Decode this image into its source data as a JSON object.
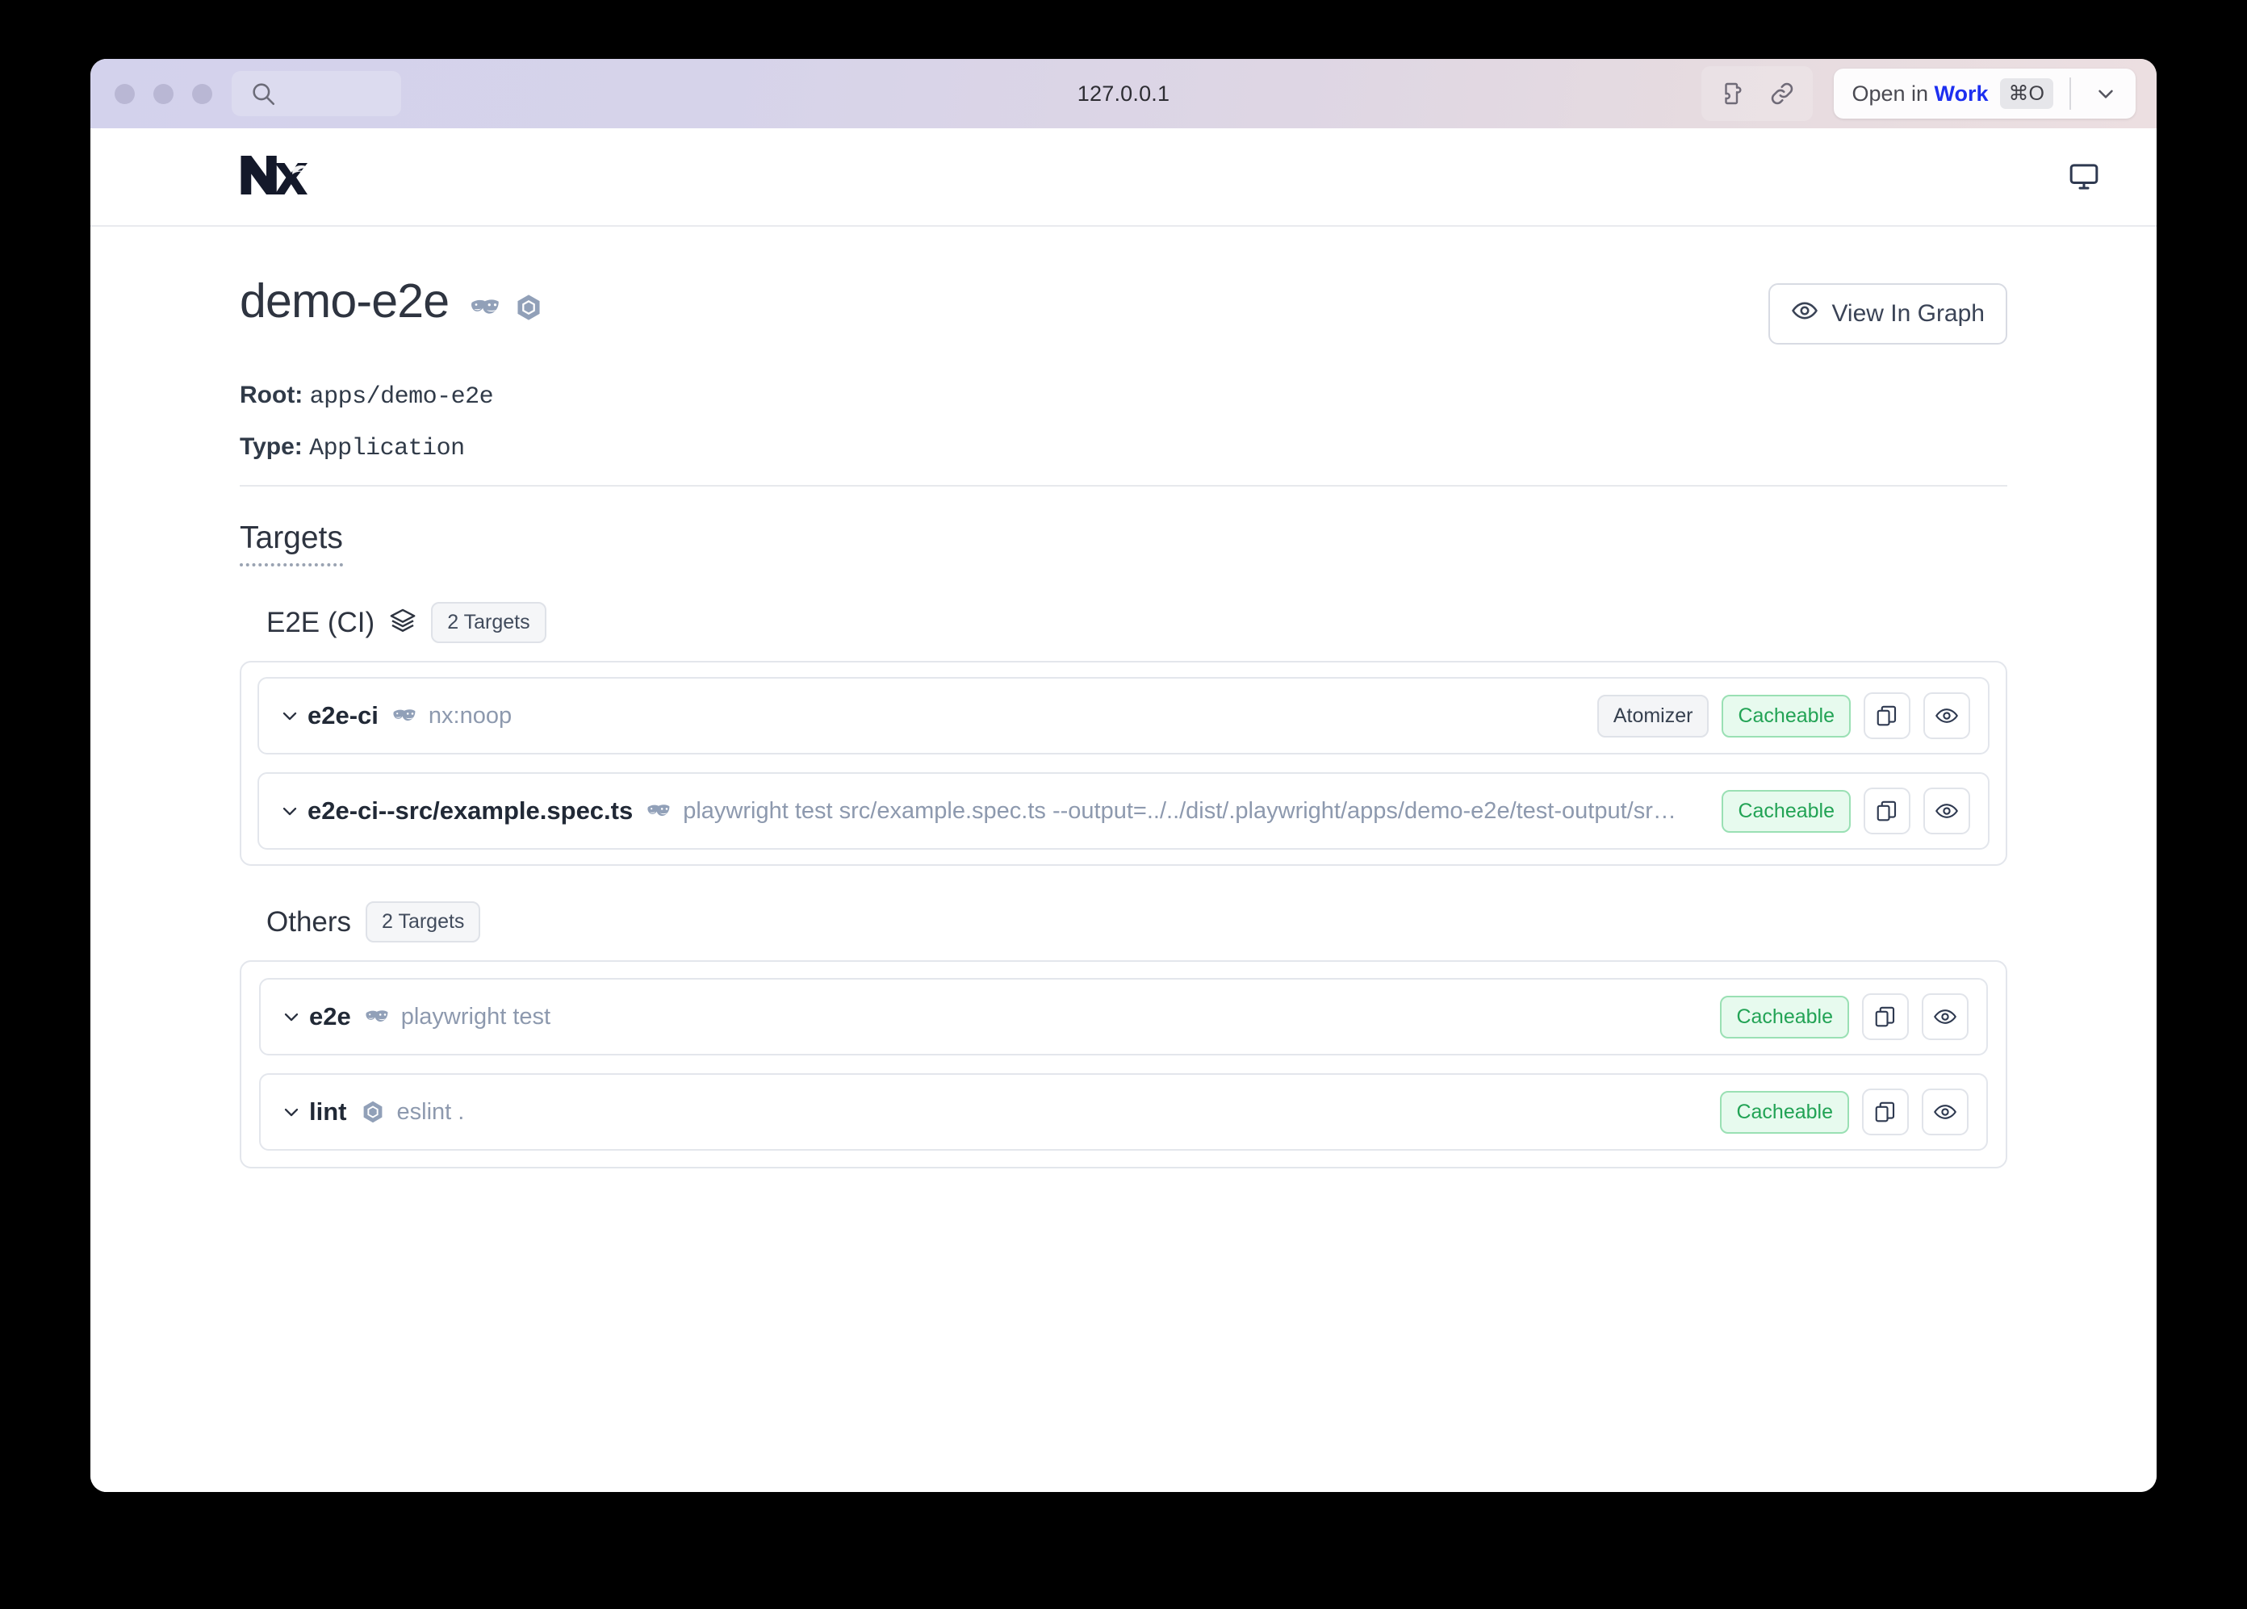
{
  "browser": {
    "url": "127.0.0.1",
    "search_icon": "search-icon",
    "extension_icon": "puzzle-piece-icon",
    "link_icon": "link-icon",
    "open_in_prefix": "Open in ",
    "open_in_app": "Work",
    "open_in_shortcut": "⌘O",
    "chevron_icon": "chevron-down-icon"
  },
  "app_header": {
    "logo": "nx-logo",
    "display_icon": "monitor-icon"
  },
  "project": {
    "title": "demo-e2e",
    "icons": [
      "playwright-masks-icon",
      "eslint-hexagon-icon"
    ],
    "view_in_graph_label": "View In Graph",
    "view_in_graph_icon": "eye-icon",
    "root_key": "Root:",
    "root_value": "apps/demo-e2e",
    "type_key": "Type:",
    "type_value": "Application"
  },
  "targets_section": {
    "heading": "Targets",
    "groups": [
      {
        "name": "E2E (CI)",
        "icon": "layers-icon",
        "count_label": "2 Targets",
        "rows": [
          {
            "chevron": "chevron-down-icon",
            "name": "e2e-ci",
            "executor_icon": "playwright-masks-icon",
            "command": "nx:noop",
            "tags": [
              "Atomizer",
              "Cacheable"
            ],
            "copy_icon": "copy-icon",
            "view_icon": "eye-icon"
          },
          {
            "chevron": "chevron-down-icon",
            "name": "e2e-ci--src/example.spec.ts",
            "executor_icon": "playwright-masks-icon",
            "command": "playwright test src/example.spec.ts --output=../../dist/.playwright/apps/demo-e2e/test-output/sr…",
            "tags": [
              "Cacheable"
            ],
            "copy_icon": "copy-icon",
            "view_icon": "eye-icon"
          }
        ]
      },
      {
        "name": "Others",
        "icon": null,
        "count_label": "2 Targets",
        "rows": [
          {
            "chevron": "chevron-down-icon",
            "name": "e2e",
            "executor_icon": "playwright-masks-icon",
            "command": "playwright test",
            "tags": [
              "Cacheable"
            ],
            "copy_icon": "copy-icon",
            "view_icon": "eye-icon"
          },
          {
            "chevron": "chevron-down-icon",
            "name": "lint",
            "executor_icon": "eslint-hexagon-icon",
            "command": "eslint .",
            "tags": [
              "Cacheable"
            ],
            "copy_icon": "copy-icon",
            "view_icon": "eye-icon"
          }
        ]
      }
    ]
  },
  "colors": {
    "accent_green": "#22a355",
    "green_bg": "#e7faee",
    "text_dark": "#2e3440",
    "text_muted": "#8d99ae",
    "border": "#e3e6ec",
    "work_blue": "#1d2ff0"
  }
}
